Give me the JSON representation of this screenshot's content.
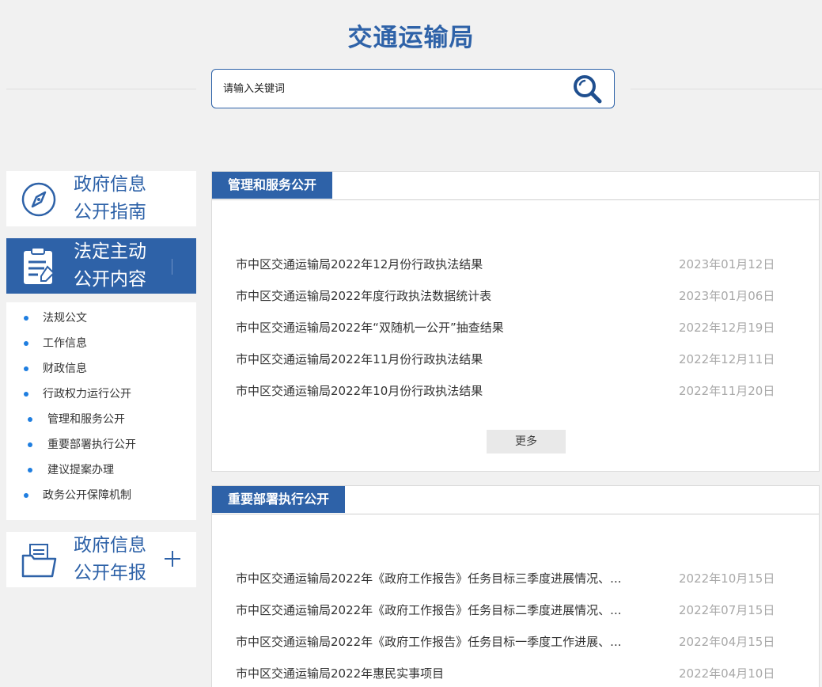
{
  "site": {
    "title": "交通运输局"
  },
  "search": {
    "placeholder": "请输入关键词"
  },
  "sidebar": {
    "guide": {
      "line1": "政府信息",
      "line2": "公开指南"
    },
    "content": {
      "line1": "法定主动",
      "line2": "公开内容"
    },
    "annual": {
      "line1": "政府信息",
      "line2": "公开年报"
    },
    "menu": [
      {
        "label": "法规公文",
        "level": 1
      },
      {
        "label": "工作信息",
        "level": 1
      },
      {
        "label": "财政信息",
        "level": 1
      },
      {
        "label": "行政权力运行公开",
        "level": 1
      },
      {
        "label": "管理和服务公开",
        "level": 2
      },
      {
        "label": "重要部署执行公开",
        "level": 2
      },
      {
        "label": "建议提案办理",
        "level": 2
      },
      {
        "label": "政务公开保障机制",
        "level": 1
      }
    ]
  },
  "sections": [
    {
      "title": "管理和服务公开",
      "more": "更多",
      "items": [
        {
          "title": "市中区交通运输局2022年12月份行政执法结果",
          "date": "2023年01月12日"
        },
        {
          "title": "市中区交通运输局2022年度行政执法数据统计表",
          "date": "2023年01月06日"
        },
        {
          "title": "市中区交通运输局2022年“双随机一公开”抽查结果",
          "date": "2022年12月19日"
        },
        {
          "title": "市中区交通运输局2022年11月份行政执法结果",
          "date": "2022年12月11日"
        },
        {
          "title": "市中区交通运输局2022年10月份行政执法结果",
          "date": "2022年11月20日"
        }
      ]
    },
    {
      "title": "重要部署执行公开",
      "items": [
        {
          "title": "市中区交通运输局2022年《政府工作报告》任务目标三季度进展情况、...",
          "date": "2022年10月15日"
        },
        {
          "title": "市中区交通运输局2022年《政府工作报告》任务目标二季度进展情况、...",
          "date": "2022年07月15日"
        },
        {
          "title": "市中区交通运输局2022年《政府工作报告》任务目标一季度工作进展、...",
          "date": "2022年04月15日"
        },
        {
          "title": "市中区交通运输局2022年惠民实事项目",
          "date": "2022年04月10日"
        }
      ]
    }
  ],
  "colors": {
    "primary": "#2e62a8",
    "bullet": "#1f7ee0",
    "date": "#a8a8a8",
    "bg": "#f1f1f1"
  }
}
